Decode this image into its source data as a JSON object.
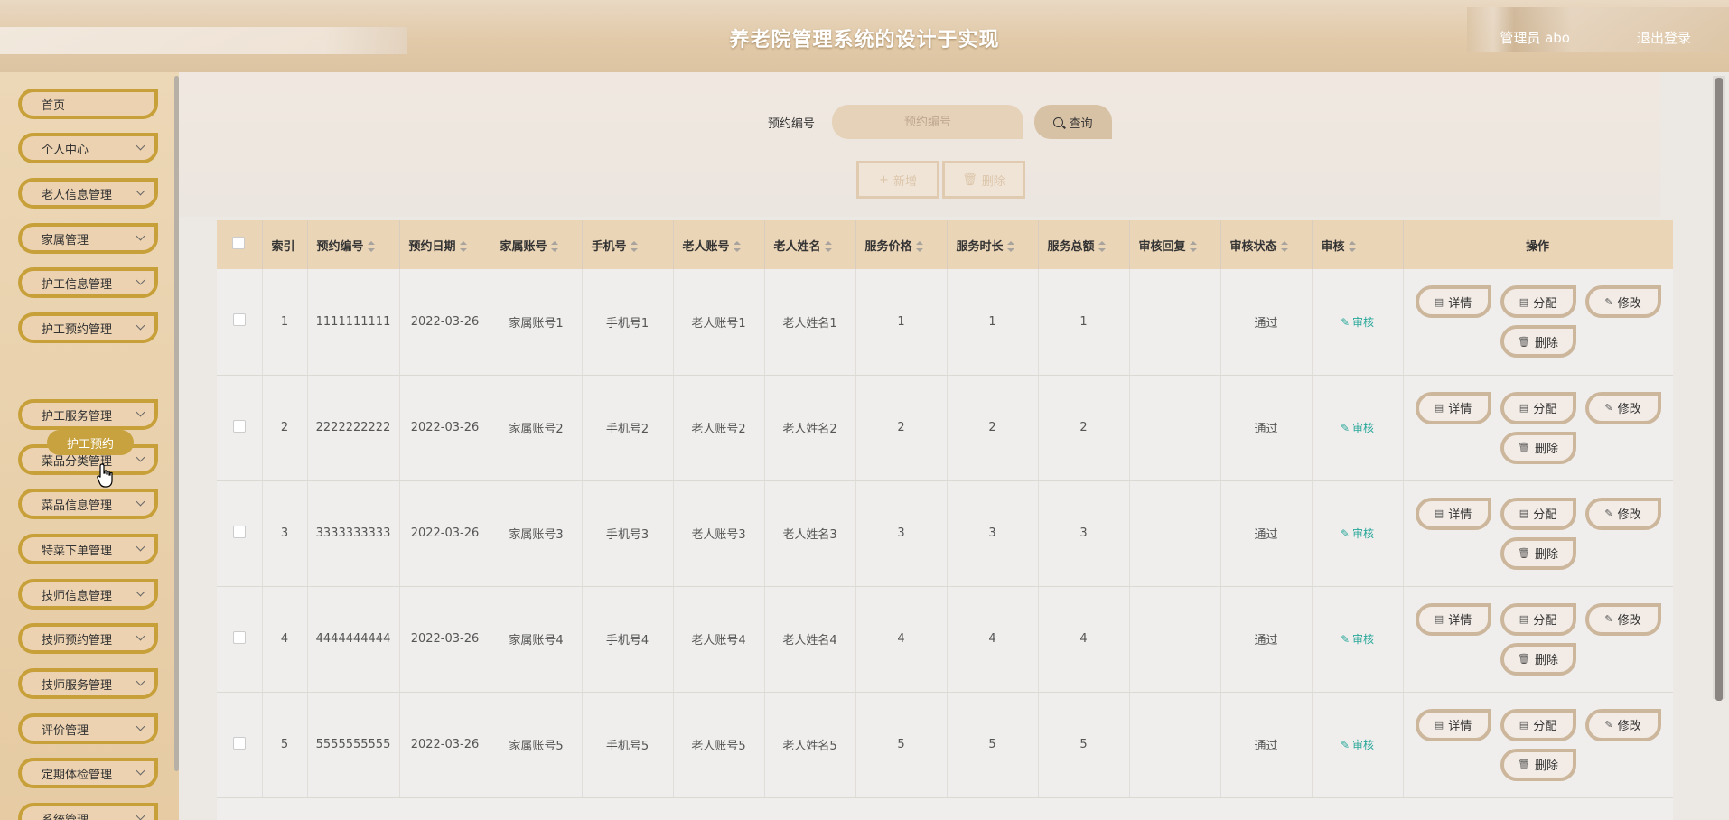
{
  "header": {
    "title": "养老院管理系统的设计于实现",
    "user": "管理员 abo",
    "logout": "退出登录"
  },
  "sidebar": {
    "items": [
      {
        "label": "首页",
        "has_children": false
      },
      {
        "label": "个人中心",
        "has_children": true
      },
      {
        "label": "老人信息管理",
        "has_children": true
      },
      {
        "label": "家属管理",
        "has_children": true
      },
      {
        "label": "护工信息管理",
        "has_children": true
      },
      {
        "label": "护工预约管理",
        "has_children": true
      },
      {
        "label": "护工服务管理",
        "has_children": true
      },
      {
        "label": "菜品分类管理",
        "has_children": true
      },
      {
        "label": "菜品信息管理",
        "has_children": true
      },
      {
        "label": "特菜下单管理",
        "has_children": true
      },
      {
        "label": "技师信息管理",
        "has_children": true
      },
      {
        "label": "技师预约管理",
        "has_children": true
      },
      {
        "label": "技师服务管理",
        "has_children": true
      },
      {
        "label": "评价管理",
        "has_children": true
      },
      {
        "label": "定期体检管理",
        "has_children": true
      },
      {
        "label": "系统管理",
        "has_children": true
      }
    ],
    "active_sub_item": "护工预约"
  },
  "search": {
    "label": "预约编号",
    "placeholder": "预约编号",
    "button": "查询"
  },
  "toolbar": {
    "add": "新增",
    "delete": "删除"
  },
  "table": {
    "columns": [
      "索引",
      "预约编号",
      "预约日期",
      "家属账号",
      "手机号",
      "老人账号",
      "老人姓名",
      "服务价格",
      "服务时长",
      "服务总额",
      "审核回复",
      "审核状态",
      "审核",
      "操作"
    ],
    "rows": [
      {
        "index": "1",
        "booking_no": "1111111111",
        "booking_date": "2022-03-26",
        "family_account": "家属账号1",
        "phone": "手机号1",
        "elder_account": "老人账号1",
        "elder_name": "老人姓名1",
        "price": "1",
        "duration": "1",
        "total": "1",
        "reply": "",
        "status": "通过"
      },
      {
        "index": "2",
        "booking_no": "2222222222",
        "booking_date": "2022-03-26",
        "family_account": "家属账号2",
        "phone": "手机号2",
        "elder_account": "老人账号2",
        "elder_name": "老人姓名2",
        "price": "2",
        "duration": "2",
        "total": "2",
        "reply": "",
        "status": "通过"
      },
      {
        "index": "3",
        "booking_no": "3333333333",
        "booking_date": "2022-03-26",
        "family_account": "家属账号3",
        "phone": "手机号3",
        "elder_account": "老人账号3",
        "elder_name": "老人姓名3",
        "price": "3",
        "duration": "3",
        "total": "3",
        "reply": "",
        "status": "通过"
      },
      {
        "index": "4",
        "booking_no": "4444444444",
        "booking_date": "2022-03-26",
        "family_account": "家属账号4",
        "phone": "手机号4",
        "elder_account": "老人账号4",
        "elder_name": "老人姓名4",
        "price": "4",
        "duration": "4",
        "total": "4",
        "reply": "",
        "status": "通过"
      },
      {
        "index": "5",
        "booking_no": "5555555555",
        "booking_date": "2022-03-26",
        "family_account": "家属账号5",
        "phone": "手机号5",
        "elder_account": "老人账号5",
        "elder_name": "老人姓名5",
        "price": "5",
        "duration": "5",
        "total": "5",
        "reply": "",
        "status": "通过"
      }
    ],
    "audit_label": "审核",
    "actions": {
      "detail": "详情",
      "assign": "分配",
      "edit": "修改",
      "delete": "删除"
    }
  },
  "colors": {
    "accent_gold": "#c8a03a",
    "header_bg": "#e2caa9",
    "table_header_bg": "#ebd5b7",
    "audit_link": "#2aa89a"
  }
}
